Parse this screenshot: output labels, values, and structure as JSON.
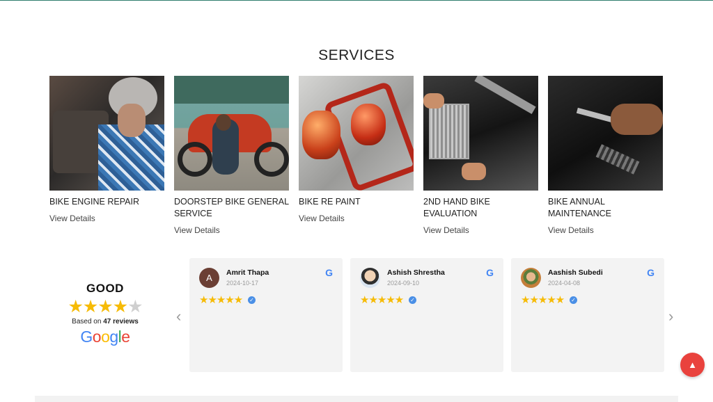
{
  "services_section": {
    "title": "SERVICES",
    "items": [
      {
        "title": "BIKE ENGINE REPAIR",
        "link": "View Details"
      },
      {
        "title": "DOORSTEP BIKE GENERAL SERVICE",
        "link": "View Details"
      },
      {
        "title": "BIKE RE PAINT",
        "link": "View Details"
      },
      {
        "title": "2ND HAND BIKE EVALUATION",
        "link": "View Details"
      },
      {
        "title": "BIKE ANNUAL MAINTENANCE",
        "link": "View Details"
      }
    ]
  },
  "rating_summary": {
    "word": "GOOD",
    "stars_filled": 4,
    "stars_total": 5,
    "based_on_prefix": "Based on",
    "review_count": "47 reviews",
    "provider_logo": "Google"
  },
  "reviews": [
    {
      "avatar_letter": "A",
      "name": "Amrit Thapa",
      "date": "2024-10-17",
      "stars": "★★★★★",
      "rating": 5
    },
    {
      "name": "Ashish Shrestha",
      "date": "2024-09-10",
      "stars": "★★★★★",
      "rating": 5
    },
    {
      "name": "Aashish Subedi",
      "date": "2024-04-08",
      "stars": "★★★★★",
      "rating": 5
    }
  ],
  "controls": {
    "prev_arrow": "‹",
    "next_arrow": "›",
    "scroll_top_glyph": "▲",
    "google_g": "G",
    "verified_glyph": "✓"
  },
  "colors": {
    "star": "#f6bb06",
    "scroll_top_button": "#e9423d",
    "verified_badge": "#4a8fe6",
    "review_card_bg": "#f3f3f3"
  },
  "icons": [
    "chevron-left-icon",
    "chevron-right-icon",
    "google-g-icon",
    "verified-icon",
    "arrow-up-icon"
  ]
}
